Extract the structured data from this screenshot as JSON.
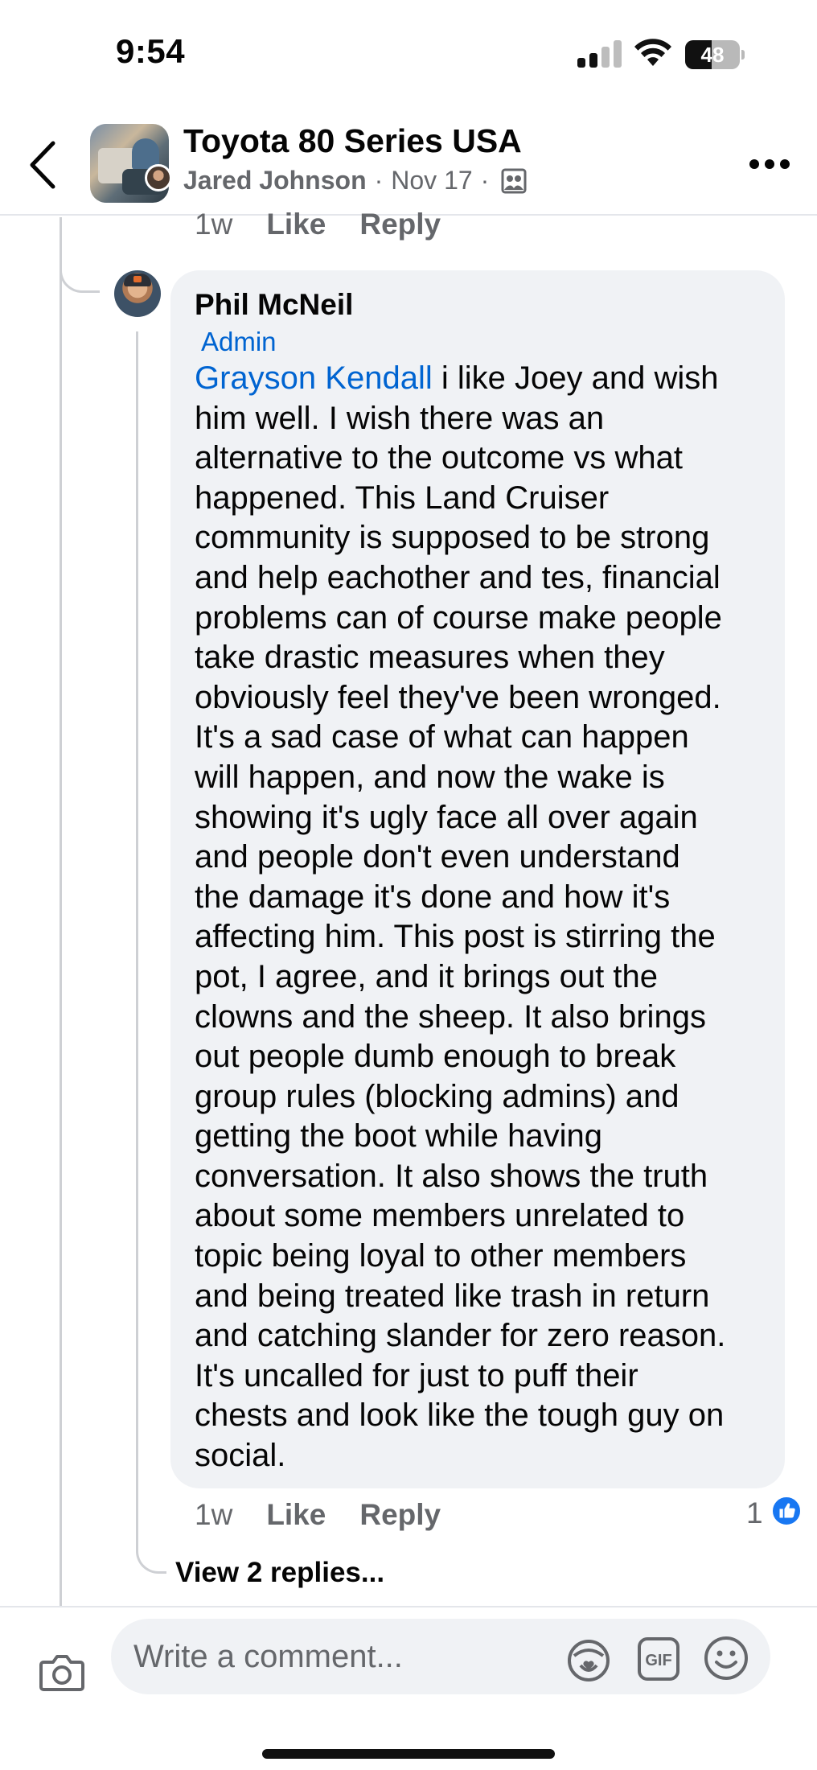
{
  "status_bar": {
    "time": "9:54",
    "battery_level": "48",
    "battery_fraction": 0.48
  },
  "header": {
    "group_name": "Toyota 80 Series USA",
    "author": "Jared Johnson",
    "date": "Nov 17",
    "separator": "·"
  },
  "previous_comment": {
    "time": "1w",
    "like_label": "Like",
    "reply_label": "Reply"
  },
  "comment": {
    "author": "Phil McNeil",
    "badge": "Admin",
    "mention": "Grayson Kendall",
    "body_lines": [
      " i like Joey and wish",
      "him well. I wish there was an",
      "alternative to the outcome vs what",
      "happened. This Land Cruiser",
      "community is supposed to be strong",
      "and help eachother and tes, financial",
      "problems can of course make people",
      "take drastic measures when they",
      "obviously feel they've been wronged.",
      "It's a sad case of what can happen",
      "will happen, and now the wake is",
      "showing it's ugly face all over again",
      "and people don't even understand",
      "the damage it's done and how it's",
      "affecting him. This post is stirring the",
      "pot, I agree, and it brings out the",
      "clowns and the sheep. It also brings",
      "out people dumb enough to break",
      "group rules (blocking admins) and",
      "getting the boot while having",
      "conversation. It also shows the truth",
      "about some members unrelated to",
      "topic being loyal to other members",
      "and being treated like trash in return",
      "and catching slander for zero reason.",
      "It's uncalled for just to puff their",
      "chests and look like the tough guy on",
      "social."
    ],
    "time": "1w",
    "like_label": "Like",
    "reply_label": "Reply",
    "like_count": "1",
    "view_replies": "View 2 replies..."
  },
  "composer": {
    "placeholder": "Write a comment..."
  },
  "icons": {
    "back": "chevron-left-icon",
    "more": "more-horizontal-icon",
    "privacy": "group-privacy-icon",
    "camera": "camera-icon",
    "avatar_sticker": "avatar-sticker-icon",
    "gif": "gif-icon",
    "emoji": "emoji-icon",
    "like": "thumbs-up-icon"
  },
  "colors": {
    "accent_blue": "#0064d1",
    "like_blue": "#1877f2",
    "bubble_bg": "#f0f2f5",
    "secondary_text": "#65676b"
  }
}
